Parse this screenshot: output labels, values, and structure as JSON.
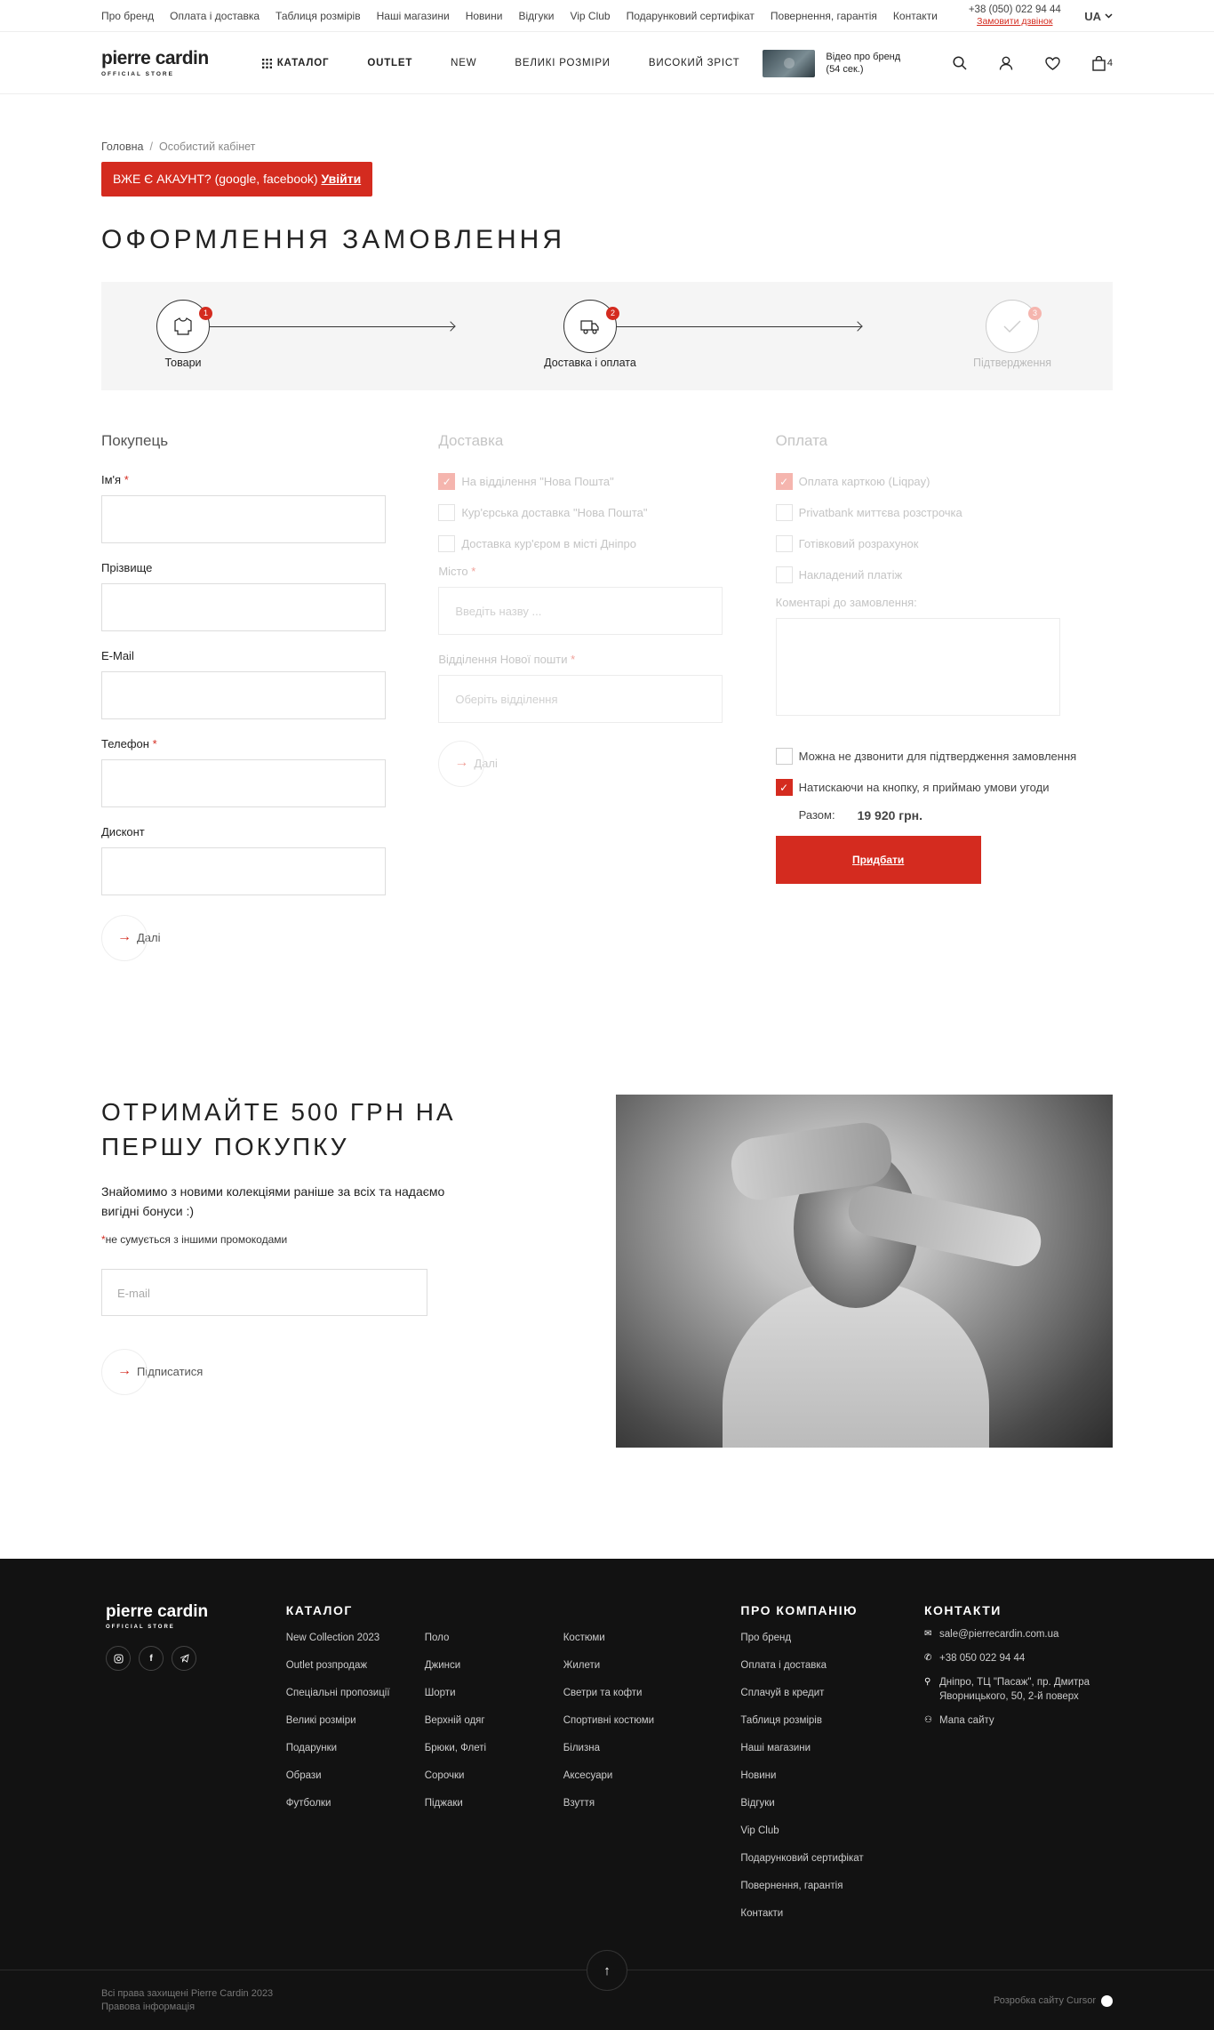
{
  "topbar": {
    "links": [
      "Про бренд",
      "Оплата і доставка",
      "Таблиця розмірів",
      "Наші магазини",
      "Новини",
      "Відгуки",
      "Vip Club",
      "Подарунковий сертифікат",
      "Повернення, гарантія",
      "Контакти"
    ],
    "phone": "+38 (050) 022 94 44",
    "call_label": "Замовити дзвінок",
    "lang": "UA"
  },
  "header": {
    "logo_main": "pierre cardin",
    "logo_sub": "OFFICIAL STORE",
    "nav": {
      "catalog": "КАТАЛОГ",
      "outlet": "OUTLET",
      "new": "NEW",
      "big": "ВЕЛИКІ РОЗМІРИ",
      "tall": "ВИСОКИЙ ЗРІСТ"
    },
    "video_line1": "Відео про бренд",
    "video_line2": "(54 сек.)",
    "cart_count": "4"
  },
  "breadcrumbs": {
    "home": "Головна",
    "separator": "/",
    "current": "Особистий кабінет"
  },
  "login_banner": {
    "text": "ВЖЕ Є АКАУНТ? (google, facebook)",
    "link": "Увійти"
  },
  "page_title": "ОФОРМЛЕННЯ ЗАМОВЛЕННЯ",
  "steps": [
    {
      "num": "1",
      "label": "Товари"
    },
    {
      "num": "2",
      "label": "Доставка і оплата"
    },
    {
      "num": "3",
      "label": "Підтвердження"
    }
  ],
  "buyer": {
    "title": "Покупець",
    "fields": {
      "name": "Ім'я",
      "surname": "Прізвище",
      "email": "E-Mail",
      "phone": "Телефон",
      "discount": "Дисконт"
    },
    "required_mark": "*",
    "next": "Далі"
  },
  "delivery": {
    "title": "Доставка",
    "options": [
      "На відділення \"Нова Пошта\"",
      "Кур'єрська доставка \"Нова Пошта\"",
      "Доставка кур'єром в місті Дніпро"
    ],
    "city_label": "Місто",
    "city_placeholder": "Введіть назву ...",
    "branch_label": "Відділення Нової пошти",
    "branch_placeholder": "Оберіть відділення",
    "next": "Далі"
  },
  "payment": {
    "title": "Оплата",
    "options": [
      "Оплата карткою (Liqpay)",
      "Privatbank миттєва розстрочка",
      "Готівковий розрахунок",
      "Накладений платіж"
    ],
    "comment_label": "Коментарі до замовлення:",
    "no_call": "Можна не дзвонити для підтвердження замовлення",
    "agree": "Натискаючи на кнопку, я приймаю умови угоди",
    "total_label": "Разом:",
    "total_value": "19 920 грн.",
    "buy": "Придбати"
  },
  "promo": {
    "title": "ОТРИМАЙТЕ 500 ГРН НА ПЕРШУ ПОКУПКУ",
    "text": "Знайомимо з новими колекціями раніше за всіх та надаємо вигідні бонуси :)",
    "note_mark": "*",
    "note": "не сумується з іншими промокодами",
    "email_placeholder": "E-mail",
    "subscribe": "Підписатися"
  },
  "footer": {
    "logo_main": "pierre cardin",
    "logo_sub": "OFFICIAL STORE",
    "catalog_title": "КАТАЛОГ",
    "catalog_col1": [
      "New Collection 2023",
      "Outlet розпродаж",
      "Спеціальні пропозиції",
      "Великі розміри",
      "Подарунки",
      "Образи",
      "Футболки"
    ],
    "catalog_col2": [
      "Поло",
      "Джинси",
      "Шорти",
      "Верхній одяг",
      "Брюки, Флеті",
      "Сорочки",
      "Піджаки"
    ],
    "catalog_col3": [
      "Костюми",
      "Жилети",
      "Светри та кофти",
      "Спортивні костюми",
      "Білизна",
      "Аксесуари",
      "Взуття"
    ],
    "about_title": "ПРО КОМПАНІЮ",
    "about": [
      "Про бренд",
      "Оплата і доставка",
      "Сплачуй в кредит",
      "Таблиця розмірів",
      "Наші магазини",
      "Новини",
      "Відгуки",
      "Vip Club",
      "Подарунковий сертифікат",
      "Повернення, гарантія",
      "Контакти"
    ],
    "contacts_title": "КОНТАКТИ",
    "email": "sale@pierrecardin.com.ua",
    "phone": "+38 050 022 94 44",
    "address": "Дніпро, ТЦ \"Пасаж\", пр. Дмитра Яворницького, 50, 2-й поверх",
    "sitemap": "Мапа сайту",
    "copyright": "Всі права захищені Pierre Cardin 2023",
    "legal": "Правова інформація",
    "developer": "Розробка сайту Cursor"
  },
  "colors": {
    "accent": "#d42b1f",
    "footer_bg": "#121212"
  }
}
